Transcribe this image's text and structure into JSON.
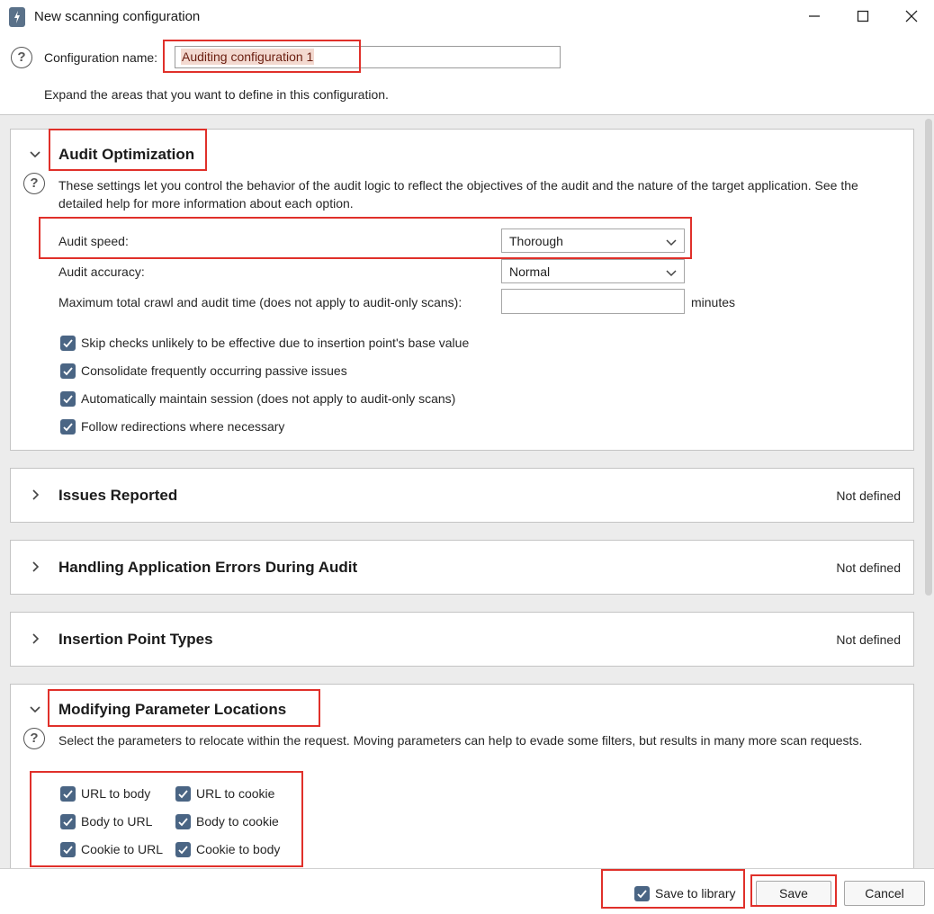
{
  "window": {
    "title": "New scanning configuration",
    "minimize_icon": "minimize-icon",
    "maximize_icon": "maximize-icon",
    "close_icon": "close-icon"
  },
  "config": {
    "label": "Configuration name:",
    "value": "Auditing configuration 1",
    "expand_note": "Expand the areas that you want to define in this configuration."
  },
  "sections": {
    "audit_optimization": {
      "title": "Audit Optimization",
      "description": "These settings let you control the behavior of the audit logic to reflect the objectives of the audit and the nature of the target application. See the detailed help for more information about each option.",
      "audit_speed_label": "Audit speed:",
      "audit_speed_value": "Thorough",
      "audit_accuracy_label": "Audit accuracy:",
      "audit_accuracy_value": "Normal",
      "max_time_label": "Maximum total crawl and audit time (does not apply to audit-only scans):",
      "max_time_value": "",
      "minutes_label": "minutes",
      "checkboxes": [
        {
          "label": "Skip checks unlikely to be effective due to insertion point's base value",
          "checked": true
        },
        {
          "label": "Consolidate frequently occurring passive issues",
          "checked": true
        },
        {
          "label": "Automatically maintain session (does not apply to audit-only scans)",
          "checked": true
        },
        {
          "label": "Follow redirections where necessary",
          "checked": true
        }
      ]
    },
    "issues_reported": {
      "title": "Issues Reported",
      "status": "Not defined"
    },
    "handling_errors": {
      "title": "Handling Application Errors During Audit",
      "status": "Not defined"
    },
    "insertion_points": {
      "title": "Insertion Point Types",
      "status": "Not defined"
    },
    "modifying_params": {
      "title": "Modifying Parameter Locations",
      "description": "Select the parameters to relocate within the request. Moving parameters can help to evade some filters, but results in many more scan requests.",
      "checkboxes": [
        {
          "label": "URL to body",
          "checked": true
        },
        {
          "label": "URL to cookie",
          "checked": true
        },
        {
          "label": "Body to URL",
          "checked": true
        },
        {
          "label": "Body to cookie",
          "checked": true
        },
        {
          "label": "Cookie to URL",
          "checked": true
        },
        {
          "label": "Cookie to body",
          "checked": true
        }
      ]
    }
  },
  "footer": {
    "save_to_library_label": "Save to library",
    "save_to_library_checked": true,
    "save_label": "Save",
    "cancel_label": "Cancel"
  },
  "colors": {
    "highlight": "#e0302a",
    "checkbox": "#4a6584",
    "section_bg": "#ffffff",
    "panel_bg": "#ececec"
  }
}
